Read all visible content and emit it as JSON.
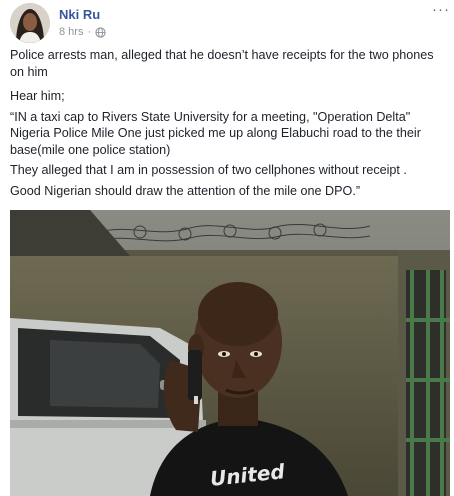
{
  "post": {
    "author": "Nki Ru",
    "time": "8 hrs",
    "privacy_icon": "globe-icon",
    "more_icon": "more-options-icon",
    "more_label": "···",
    "paragraphs": [
      "Police arrests man, alleged that he doesn’t have receipts for the two phones on him",
      "Hear him;",
      "“IN a taxi cap to Rivers State University for a meeting, \"Operation Delta\" Nigeria Police Mile One just picked me up along Elabuchi road to the their base(mile one police station)",
      "They alleged that I am in possession of two cellphones without receipt .",
      "Good Nigerian should draw the attention of the mile one DPO.”"
    ],
    "photo_shirt_text": "United"
  }
}
